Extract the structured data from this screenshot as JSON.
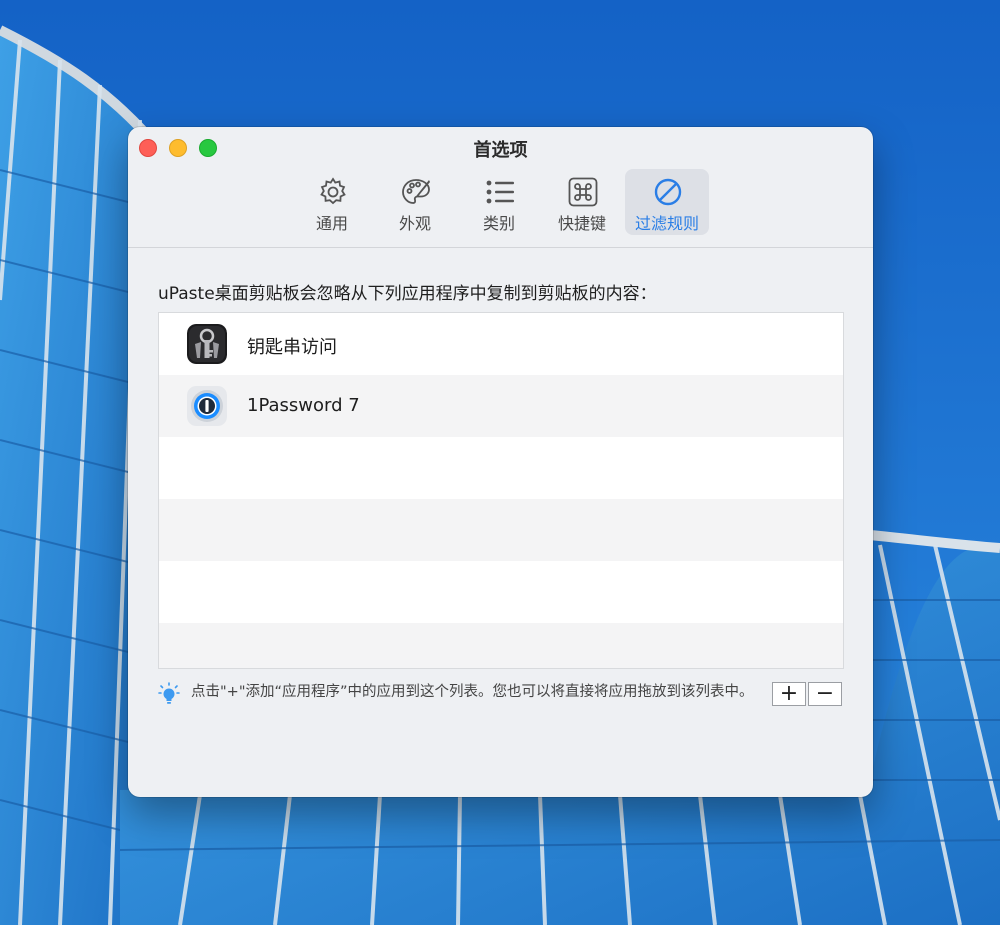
{
  "window": {
    "title": "首选项"
  },
  "tabs": [
    {
      "label": "通用",
      "icon": "gear-icon"
    },
    {
      "label": "外观",
      "icon": "palette-icon"
    },
    {
      "label": "类别",
      "icon": "list-icon"
    },
    {
      "label": "快捷键",
      "icon": "command-key-icon"
    },
    {
      "label": "过滤规则",
      "icon": "prohibited-icon",
      "active": true
    }
  ],
  "filter": {
    "description": "uPaste桌面剪贴板会忽略从下列应用程序中复制到剪贴板的内容：",
    "apps": [
      {
        "name": "钥匙串访问",
        "icon": "keychain-access-icon"
      },
      {
        "name": "1Password 7",
        "icon": "1password-icon"
      }
    ],
    "hint": "点击\"+\"添加“应用程序”中的应用到这个列表。您也可以将直接将应用拖放到该列表中。",
    "add_label": "+",
    "remove_label": "−"
  },
  "colors": {
    "accent": "#2a7ee6",
    "close": "#fe5f57",
    "minimize": "#febc2e",
    "maximize": "#28c840"
  }
}
